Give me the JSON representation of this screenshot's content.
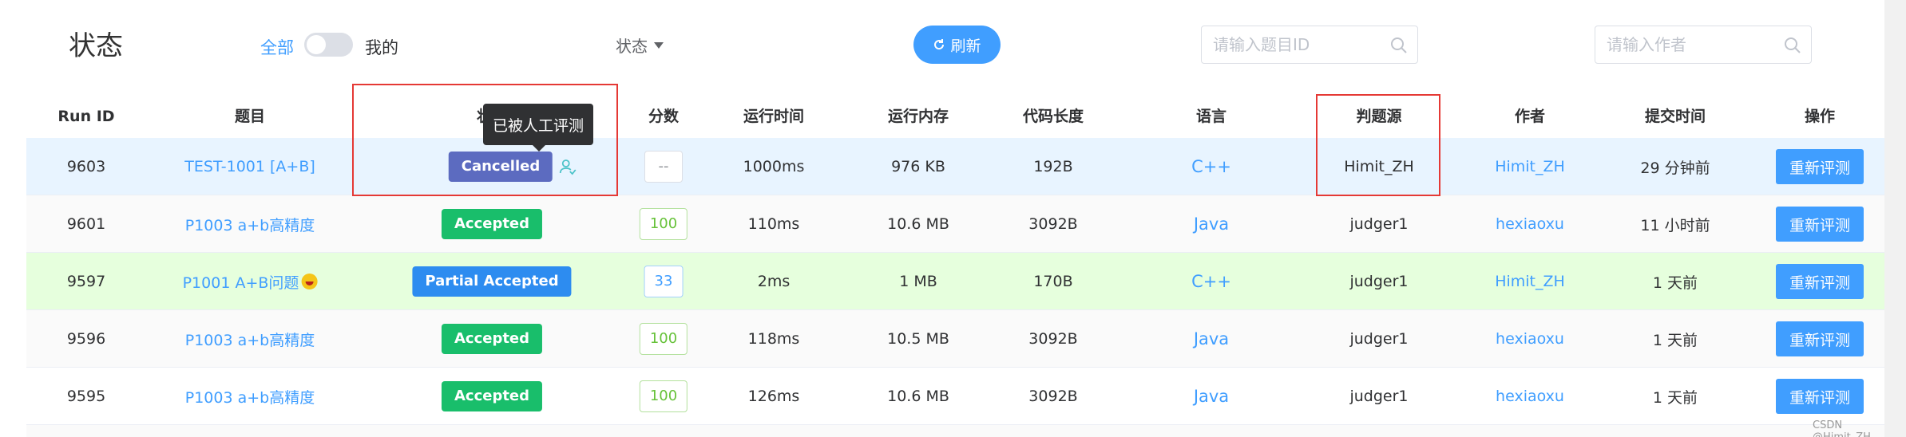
{
  "header": {
    "title": "状态",
    "scope_all": "全部",
    "scope_mine": "我的",
    "status_filter": "状态",
    "refresh": "刷新",
    "problem_search_placeholder": "请输入题目ID",
    "author_search_placeholder": "请输入作者"
  },
  "table": {
    "columns": [
      "Run ID",
      "题目",
      "状态",
      "分数",
      "运行时间",
      "运行内存",
      "代码长度",
      "语言",
      "判题源",
      "作者",
      "提交时间",
      "操作"
    ],
    "rows": [
      {
        "run_id": "9603",
        "problem": "TEST-1001 [A+B]",
        "status": "Cancelled",
        "score": "--",
        "time": "1000ms",
        "memory": "976 KB",
        "length": "192B",
        "language": "C++",
        "judger": "Himit_ZH",
        "author": "Himit_ZH",
        "submit_time": "29 分钟前",
        "action": "重新评测"
      },
      {
        "run_id": "9601",
        "problem": "P1003 a+b高精度",
        "status": "Accepted",
        "score": "100",
        "time": "110ms",
        "memory": "10.6 MB",
        "length": "3092B",
        "language": "Java",
        "judger": "judger1",
        "author": "hexiaoxu",
        "submit_time": "11 小时前",
        "action": "重新评测"
      },
      {
        "run_id": "9597",
        "problem": "P1001 A+B问题",
        "status": "Partial Accepted",
        "score": "33",
        "time": "2ms",
        "memory": "1 MB",
        "length": "170B",
        "language": "C++",
        "judger": "judger1",
        "author": "Himit_ZH",
        "submit_time": "1 天前",
        "action": "重新评测"
      },
      {
        "run_id": "9596",
        "problem": "P1003 a+b高精度",
        "status": "Accepted",
        "score": "100",
        "time": "118ms",
        "memory": "10.5 MB",
        "length": "3092B",
        "language": "Java",
        "judger": "judger1",
        "author": "hexiaoxu",
        "submit_time": "1 天前",
        "action": "重新评测"
      },
      {
        "run_id": "9595",
        "problem": "P1003 a+b高精度",
        "status": "Accepted",
        "score": "100",
        "time": "126ms",
        "memory": "10.6 MB",
        "length": "3092B",
        "language": "Java",
        "judger": "judger1",
        "author": "hexiaoxu",
        "submit_time": "1 天前",
        "action": "重新评测"
      }
    ]
  },
  "tooltip": "已被人工评测",
  "watermark": "CSDN @Himit_ZH",
  "colors": {
    "primary": "#409eff",
    "accepted": "#19be6b",
    "cancelled": "#5c6bc0",
    "partial": "#2d8cf0",
    "highlight": "#e53935"
  }
}
